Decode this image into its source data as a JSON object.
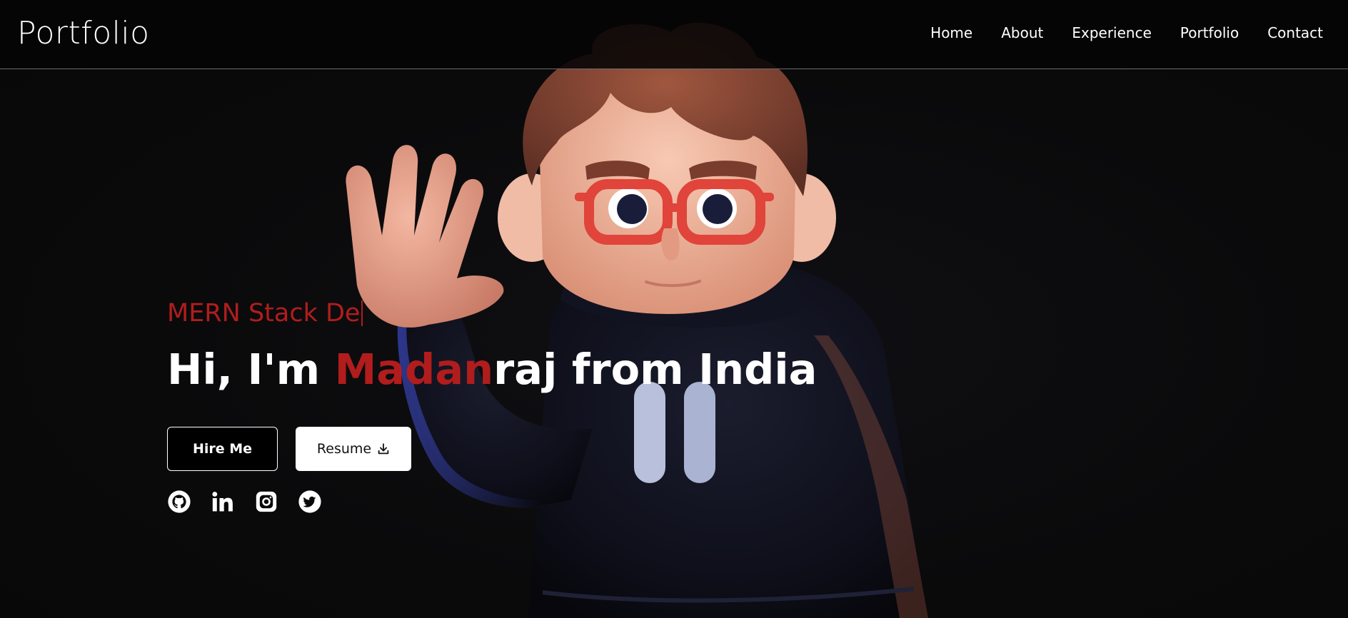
{
  "brand": "Portfolio",
  "nav": {
    "items": [
      {
        "label": "Home"
      },
      {
        "label": "About"
      },
      {
        "label": "Experience"
      },
      {
        "label": "Portfolio"
      },
      {
        "label": "Contact"
      }
    ]
  },
  "hero": {
    "typed_role": "MERN Stack De",
    "headline_prefix": "Hi, I'm ",
    "headline_accent": "Madan",
    "headline_suffix": "raj from India"
  },
  "buttons": {
    "hire_label": "Hire Me",
    "resume_label": "Resume"
  },
  "socials": [
    {
      "icon": "github-icon"
    },
    {
      "icon": "linkedin-icon"
    },
    {
      "icon": "instagram-icon"
    },
    {
      "icon": "twitter-icon"
    }
  ],
  "colors": {
    "accent": "#b11d1d",
    "background": "#090909",
    "text": "#ffffff"
  }
}
